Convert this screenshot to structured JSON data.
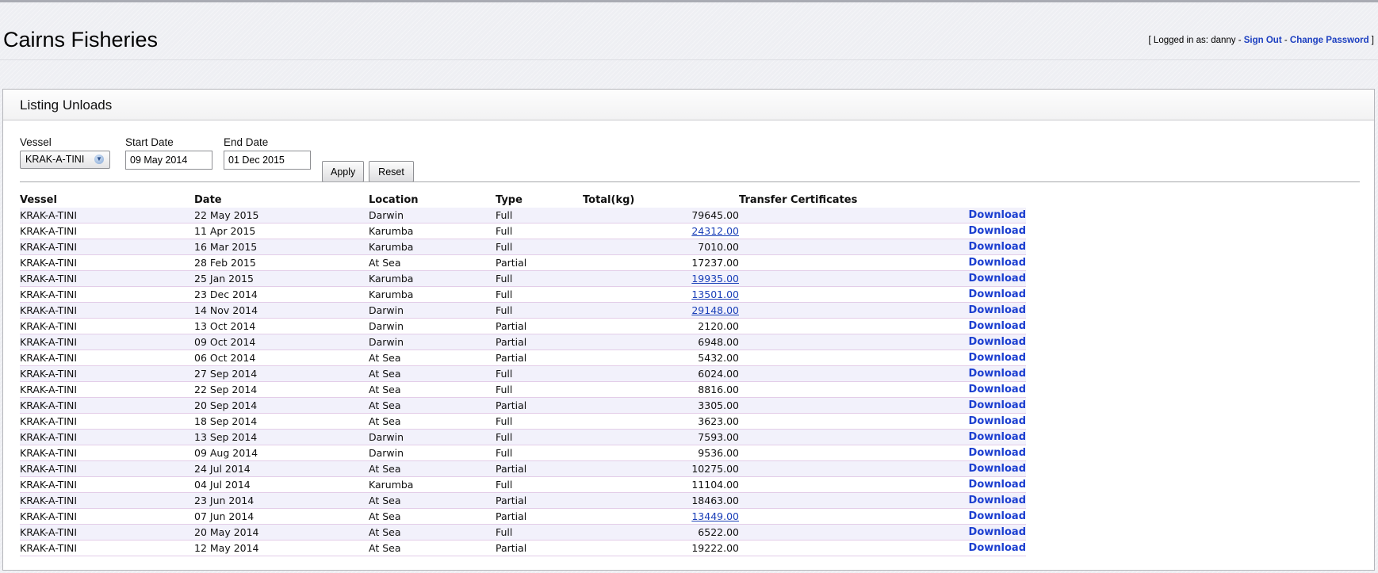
{
  "app": {
    "title": "Cairns Fisheries"
  },
  "user_bar": {
    "open_bracket": "[ Logged in as: danny - ",
    "sign_out": "Sign Out",
    "separator": " - ",
    "change_password": "Change Password",
    "close_bracket": " ]"
  },
  "panel": {
    "title": "Listing Unloads"
  },
  "filters": {
    "vessel_label": "Vessel",
    "vessel_value": "KRAK-A-TINI",
    "start_label": "Start Date",
    "start_value": "09 May 2014",
    "end_label": "End Date",
    "end_value": "01 Dec 2015",
    "apply": "Apply",
    "reset": "Reset"
  },
  "table": {
    "headers": {
      "vessel": "Vessel",
      "date": "Date",
      "location": "Location",
      "type": "Type",
      "total": "Total(kg)",
      "cert": "Transfer Certificates"
    },
    "download_label": "Download",
    "rows": [
      {
        "vessel": "KRAK-A-TINI",
        "date": "22 May 2015",
        "location": "Darwin",
        "type": "Full",
        "total": "79645.00",
        "total_link": false
      },
      {
        "vessel": "KRAK-A-TINI",
        "date": "11 Apr 2015",
        "location": "Karumba",
        "type": "Full",
        "total": "24312.00",
        "total_link": true
      },
      {
        "vessel": "KRAK-A-TINI",
        "date": "16 Mar 2015",
        "location": "Karumba",
        "type": "Full",
        "total": "7010.00",
        "total_link": false
      },
      {
        "vessel": "KRAK-A-TINI",
        "date": "28 Feb 2015",
        "location": "At Sea",
        "type": "Partial",
        "total": "17237.00",
        "total_link": false
      },
      {
        "vessel": "KRAK-A-TINI",
        "date": "25 Jan 2015",
        "location": "Karumba",
        "type": "Full",
        "total": "19935.00",
        "total_link": true
      },
      {
        "vessel": "KRAK-A-TINI",
        "date": "23 Dec 2014",
        "location": "Karumba",
        "type": "Full",
        "total": "13501.00",
        "total_link": true
      },
      {
        "vessel": "KRAK-A-TINI",
        "date": "14 Nov 2014",
        "location": "Darwin",
        "type": "Full",
        "total": "29148.00",
        "total_link": true
      },
      {
        "vessel": "KRAK-A-TINI",
        "date": "13 Oct 2014",
        "location": "Darwin",
        "type": "Partial",
        "total": "2120.00",
        "total_link": false
      },
      {
        "vessel": "KRAK-A-TINI",
        "date": "09 Oct 2014",
        "location": "Darwin",
        "type": "Partial",
        "total": "6948.00",
        "total_link": false
      },
      {
        "vessel": "KRAK-A-TINI",
        "date": "06 Oct 2014",
        "location": "At Sea",
        "type": "Partial",
        "total": "5432.00",
        "total_link": false
      },
      {
        "vessel": "KRAK-A-TINI",
        "date": "27 Sep 2014",
        "location": "At Sea",
        "type": "Full",
        "total": "6024.00",
        "total_link": false
      },
      {
        "vessel": "KRAK-A-TINI",
        "date": "22 Sep 2014",
        "location": "At Sea",
        "type": "Full",
        "total": "8816.00",
        "total_link": false
      },
      {
        "vessel": "KRAK-A-TINI",
        "date": "20 Sep 2014",
        "location": "At Sea",
        "type": "Partial",
        "total": "3305.00",
        "total_link": false
      },
      {
        "vessel": "KRAK-A-TINI",
        "date": "18 Sep 2014",
        "location": "At Sea",
        "type": "Full",
        "total": "3623.00",
        "total_link": false
      },
      {
        "vessel": "KRAK-A-TINI",
        "date": "13 Sep 2014",
        "location": "Darwin",
        "type": "Full",
        "total": "7593.00",
        "total_link": false
      },
      {
        "vessel": "KRAK-A-TINI",
        "date": "09 Aug 2014",
        "location": "Darwin",
        "type": "Full",
        "total": "9536.00",
        "total_link": false
      },
      {
        "vessel": "KRAK-A-TINI",
        "date": "24 Jul 2014",
        "location": "At Sea",
        "type": "Partial",
        "total": "10275.00",
        "total_link": false
      },
      {
        "vessel": "KRAK-A-TINI",
        "date": "04 Jul 2014",
        "location": "Karumba",
        "type": "Full",
        "total": "11104.00",
        "total_link": false
      },
      {
        "vessel": "KRAK-A-TINI",
        "date": "23 Jun 2014",
        "location": "At Sea",
        "type": "Partial",
        "total": "18463.00",
        "total_link": false
      },
      {
        "vessel": "KRAK-A-TINI",
        "date": "07 Jun 2014",
        "location": "At Sea",
        "type": "Partial",
        "total": "13449.00",
        "total_link": true
      },
      {
        "vessel": "KRAK-A-TINI",
        "date": "20 May 2014",
        "location": "At Sea",
        "type": "Full",
        "total": "6522.00",
        "total_link": false
      },
      {
        "vessel": "KRAK-A-TINI",
        "date": "12 May 2014",
        "location": "At Sea",
        "type": "Partial",
        "total": "19222.00",
        "total_link": false
      }
    ]
  },
  "colors": {
    "link": "#1c3fd0",
    "row_alt": "#f2f1fb",
    "row_border": "#e3cde8"
  },
  "icons": {
    "select_arrow": "chevron-down-icon"
  }
}
